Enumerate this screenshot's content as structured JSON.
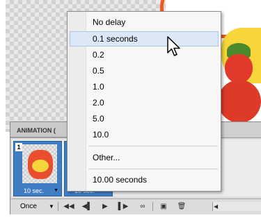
{
  "panel": {
    "title": "ANIMATION (",
    "frames": [
      {
        "number": "1",
        "delay": "10 sec."
      },
      {
        "number": "",
        "delay": "10 sec."
      }
    ],
    "loop": "Once"
  },
  "delay_menu": {
    "items": [
      {
        "label": "No delay",
        "highlighted": false
      },
      {
        "label": "0.1 seconds",
        "highlighted": true
      },
      {
        "label": "0.2",
        "highlighted": false
      },
      {
        "label": "0.5",
        "highlighted": false
      },
      {
        "label": "1.0",
        "highlighted": false
      },
      {
        "label": "2.0",
        "highlighted": false
      },
      {
        "label": "5.0",
        "highlighted": false
      },
      {
        "label": "10.0",
        "highlighted": false
      }
    ],
    "other": "Other...",
    "current": "10.00 seconds"
  },
  "colors": {
    "frame_selected": "#3f7ec5",
    "menu_highlight": "#dde8f6"
  }
}
